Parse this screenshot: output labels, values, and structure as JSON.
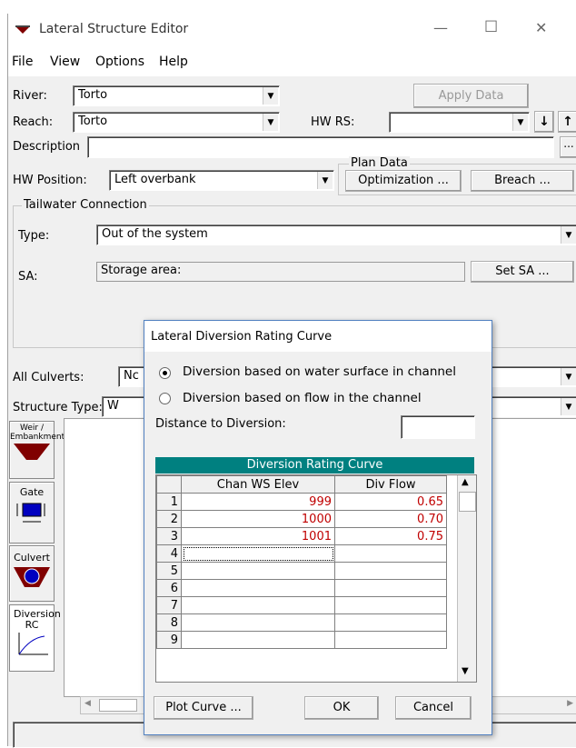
{
  "window": {
    "title": "Lateral Structure Editor",
    "minimize_glyph": "—",
    "maximize_glyph": "☐",
    "close_glyph": "✕"
  },
  "menu": [
    "File",
    "View",
    "Options",
    "Help"
  ],
  "river": {
    "label": "River:",
    "value": "Torto"
  },
  "reach": {
    "label": "Reach:",
    "value": "Torto"
  },
  "hw_rs": {
    "label": "HW RS:",
    "value": ""
  },
  "apply_button": "Apply Data",
  "description": {
    "label": "Description",
    "value": "",
    "more_button": "..."
  },
  "hw_position": {
    "label": "HW Position:",
    "value": "Left overbank"
  },
  "plan_data": {
    "title": "Plan Data",
    "optimization_button": "Optimization ...",
    "breach_button": "Breach ..."
  },
  "tailwater": {
    "title": "Tailwater Connection",
    "type_label": "Type:",
    "type_value": "Out of the system",
    "sa_label": "SA:",
    "sa_value": "Storage area:",
    "set_sa_button": "Set SA ..."
  },
  "all_culverts": {
    "label": "All Culverts:",
    "value": "Nc"
  },
  "structure_type": {
    "label": "Structure Type:",
    "value": "W"
  },
  "tools": [
    {
      "label": "Weir / Embankment"
    },
    {
      "label": "Gate"
    },
    {
      "label": "Culvert"
    },
    {
      "label": "Diversion RC"
    }
  ],
  "dialog": {
    "title": "Lateral Diversion Rating Curve",
    "radio1": "Diversion based on water surface in channel",
    "radio2": "Diversion based on flow in the channel",
    "distance_label": "Distance to Diversion:",
    "distance_value": "",
    "table_title": "Diversion Rating Curve",
    "col1": "Chan WS Elev",
    "col2": "Div Flow",
    "rows": [
      {
        "n": "1",
        "elev": "999",
        "flow": "0.65"
      },
      {
        "n": "2",
        "elev": "1000",
        "flow": "0.70"
      },
      {
        "n": "3",
        "elev": "1001",
        "flow": "0.75"
      },
      {
        "n": "4",
        "elev": "",
        "flow": ""
      },
      {
        "n": "5",
        "elev": "",
        "flow": ""
      },
      {
        "n": "6",
        "elev": "",
        "flow": ""
      },
      {
        "n": "7",
        "elev": "",
        "flow": ""
      },
      {
        "n": "8",
        "elev": "",
        "flow": ""
      },
      {
        "n": "9",
        "elev": "",
        "flow": ""
      }
    ],
    "plot_button": "Plot Curve ...",
    "ok_button": "OK",
    "cancel_button": "Cancel"
  },
  "colors": {
    "grid_header": "#008080",
    "data_text": "#c00000",
    "window_bg": "#f0f0f0",
    "accent_icon": "#800000",
    "tool_blue": "#0000c0"
  }
}
